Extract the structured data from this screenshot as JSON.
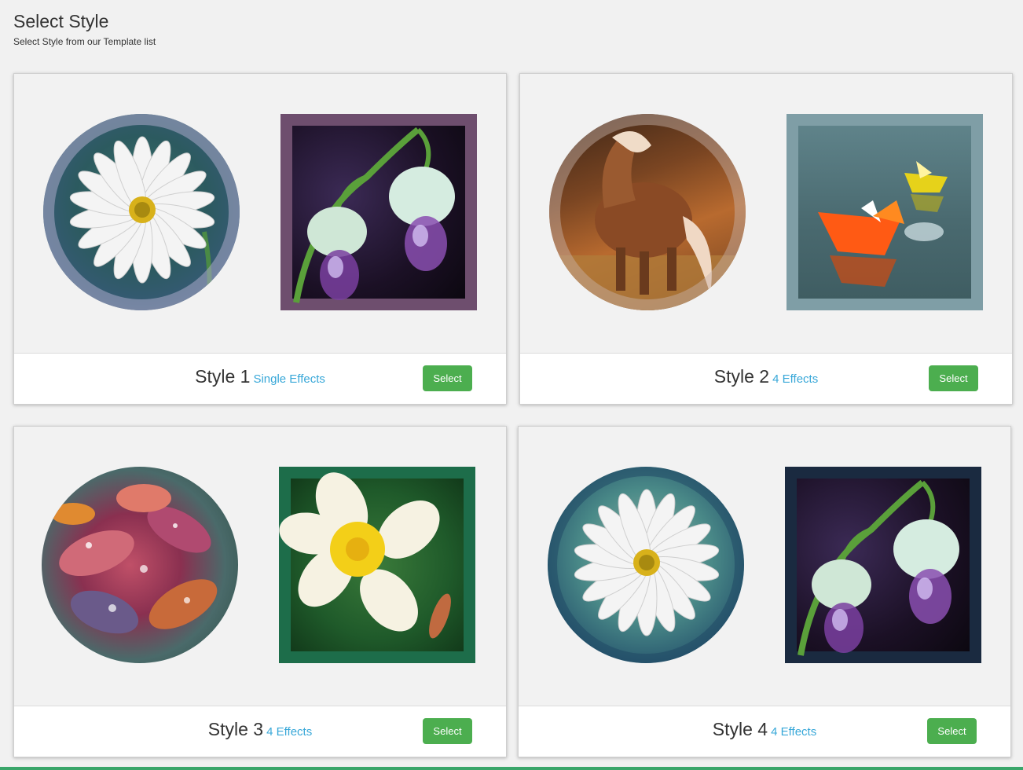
{
  "page": {
    "title": "Select Style",
    "subtitle": "Select Style from our Template list"
  },
  "styles": [
    {
      "name": "Style 1",
      "effects": "Single Effects",
      "button": "Select",
      "circle_image": "daisy",
      "square_image": "lily-of-the-valley"
    },
    {
      "name": "Style 2",
      "effects": "4 Effects",
      "button": "Select",
      "circle_image": "horse",
      "square_image": "paper-boats"
    },
    {
      "name": "Style 3",
      "effects": "4 Effects",
      "button": "Select",
      "circle_image": "wet-leaves",
      "square_image": "plumeria"
    },
    {
      "name": "Style 4",
      "effects": "4 Effects",
      "button": "Select",
      "circle_image": "daisy",
      "square_image": "lily-of-the-valley"
    }
  ],
  "colors": {
    "background": "#f1f1f1",
    "button": "#4cae4f",
    "effects_link": "#37a7d8",
    "bottom_bar": "#3aa66a"
  }
}
